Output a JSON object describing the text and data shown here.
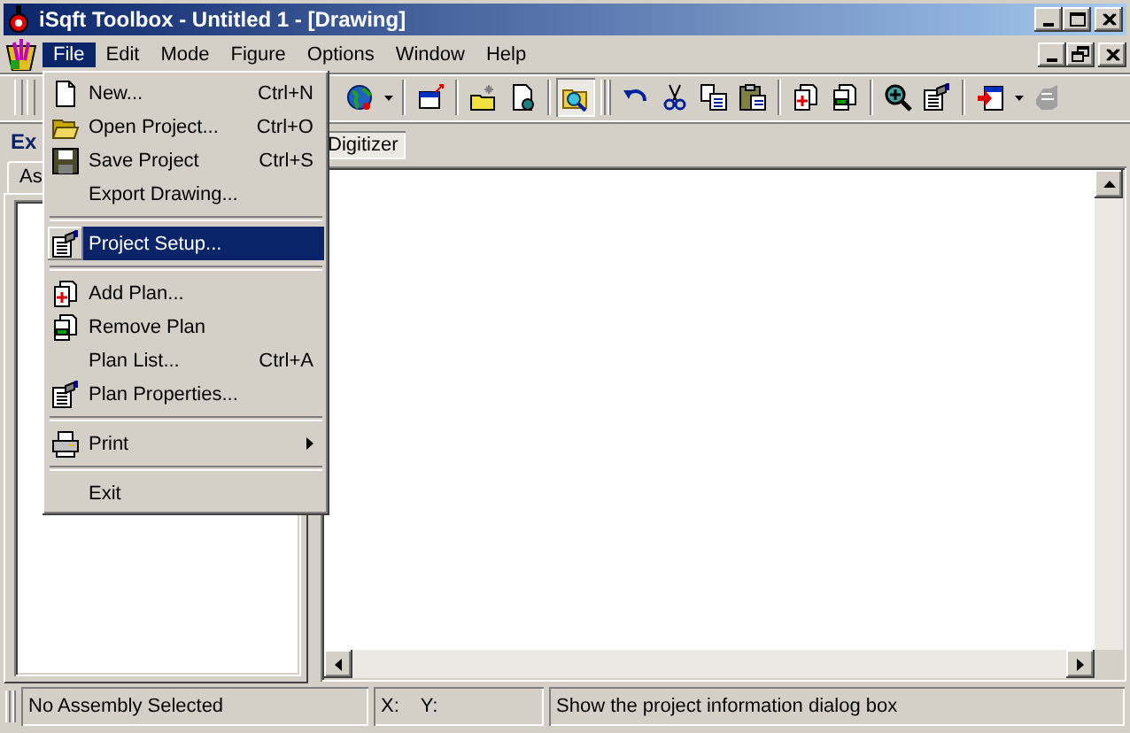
{
  "window": {
    "title": "iSqft Toolbox - Untitled 1 - [Drawing]"
  },
  "menu_bar": [
    {
      "label": "File",
      "selected": true
    },
    {
      "label": "Edit",
      "selected": false
    },
    {
      "label": "Mode",
      "selected": false
    },
    {
      "label": "Figure",
      "selected": false
    },
    {
      "label": "Options",
      "selected": false
    },
    {
      "label": "Window",
      "selected": false
    },
    {
      "label": "Help",
      "selected": false
    }
  ],
  "file_menu": [
    {
      "kind": "item",
      "label": "New...",
      "shortcut": "Ctrl+N",
      "selected": false
    },
    {
      "kind": "item",
      "label": "Open Project...",
      "shortcut": "Ctrl+O",
      "selected": false
    },
    {
      "kind": "item",
      "label": "Save Project",
      "shortcut": "Ctrl+S",
      "selected": false
    },
    {
      "kind": "item",
      "label": "Export Drawing...",
      "selected": false
    },
    {
      "kind": "separator"
    },
    {
      "kind": "item",
      "label": "Project Setup...",
      "selected": true
    },
    {
      "kind": "separator"
    },
    {
      "kind": "item",
      "label": "Add Plan...",
      "selected": false
    },
    {
      "kind": "item",
      "label": "Remove Plan",
      "selected": false
    },
    {
      "kind": "item",
      "label": "Plan List...",
      "shortcut": "Ctrl+A",
      "selected": false
    },
    {
      "kind": "item",
      "label": "Plan Properties...",
      "selected": false
    },
    {
      "kind": "separator"
    },
    {
      "kind": "submenu",
      "label": "Print",
      "selected": false
    },
    {
      "kind": "separator"
    },
    {
      "kind": "item",
      "label": "Exit",
      "selected": false
    }
  ],
  "toolbar": [
    {
      "kind": "button",
      "pressed": false
    },
    {
      "kind": "dropdown"
    },
    {
      "kind": "separator"
    },
    {
      "kind": "button",
      "pressed": false
    },
    {
      "kind": "separator"
    },
    {
      "kind": "button",
      "pressed": false
    },
    {
      "kind": "button",
      "pressed": false
    },
    {
      "kind": "separator"
    },
    {
      "kind": "button",
      "pressed": true
    },
    {
      "kind": "grip"
    },
    {
      "kind": "button",
      "pressed": false
    },
    {
      "kind": "button",
      "pressed": false
    },
    {
      "kind": "button",
      "pressed": false
    },
    {
      "kind": "button",
      "pressed": false
    },
    {
      "kind": "separator"
    },
    {
      "kind": "button",
      "pressed": false
    },
    {
      "kind": "button",
      "pressed": false
    },
    {
      "kind": "separator"
    },
    {
      "kind": "button",
      "pressed": false
    },
    {
      "kind": "button",
      "pressed": false
    },
    {
      "kind": "separator"
    },
    {
      "kind": "button",
      "pressed": false
    },
    {
      "kind": "dropdown"
    },
    {
      "kind": "button",
      "pressed": false
    }
  ],
  "left_panel": {
    "title": "Ex",
    "tab": "As"
  },
  "document_tab": "Digitizer",
  "status_bar": {
    "assembly": "No Assembly Selected",
    "x_label": "X:",
    "y_label": "Y:",
    "message": "Show the project information dialog box"
  }
}
